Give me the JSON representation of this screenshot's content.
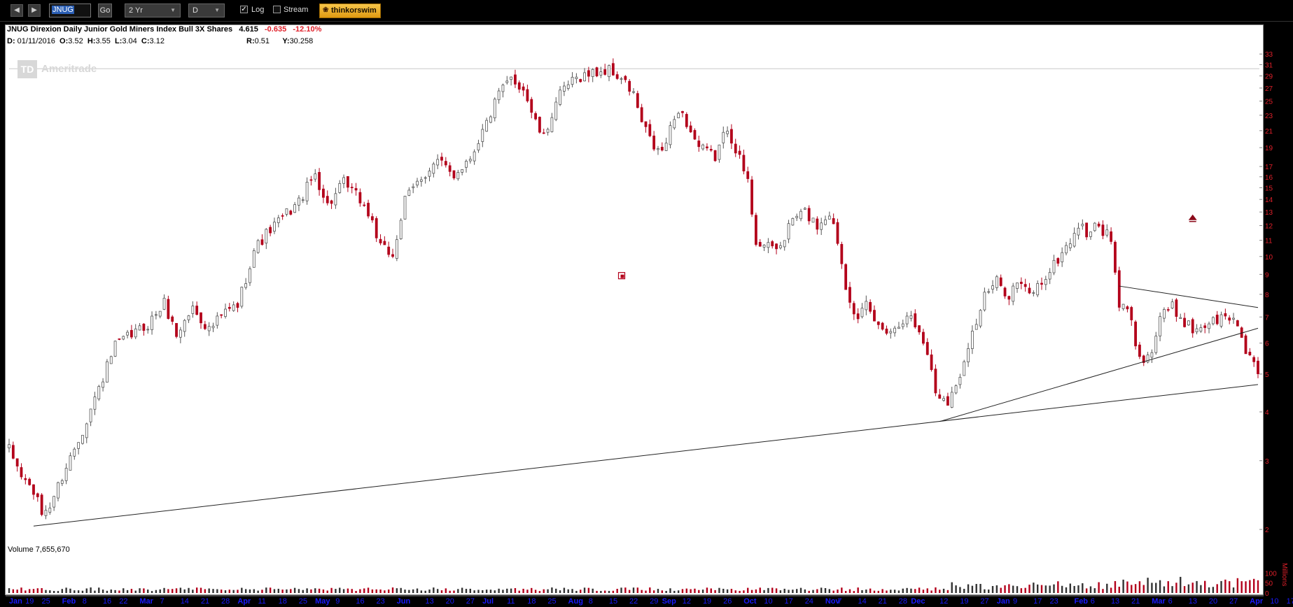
{
  "toolbar": {
    "back_icon": "left-arrow-icon",
    "forward_icon": "right-arrow-icon",
    "symbol": "JNUG",
    "go_label": "Go",
    "period": "2 Yr",
    "interval": "D",
    "log_label": "Log",
    "log_checked": true,
    "stream_label": "Stream",
    "stream_checked": false,
    "brand_label": "thinkorswim"
  },
  "header": {
    "title": "JNUG Direxion Daily Junior Gold Miners Index Bull 3X Shares",
    "last": "4.615",
    "change": "-0.635",
    "change_pct": "-12.10%",
    "date_label": "D:",
    "date": "01/11/2016",
    "open_label": "O:",
    "open": "3.52",
    "high_label": "H:",
    "high": "3.55",
    "low_label": "L:",
    "low": "3.04",
    "close_label": "C:",
    "close": "3.12",
    "r_label": "R:",
    "r": "0.51",
    "y_label": "Y:",
    "y": "30.258"
  },
  "watermark": {
    "logo": "TD",
    "text": "Ameritrade"
  },
  "volume_label": "Volume 7,655,670",
  "colors": {
    "up": "#555555",
    "down": "#b3001b",
    "axis_text": "#e0202a",
    "x_text": "#1a1aff"
  },
  "chart_data": {
    "type": "candlestick",
    "yscale": "log",
    "ylim": [
      1.85,
      34
    ],
    "y_ticks": [
      2,
      3,
      4,
      5,
      6,
      7,
      8,
      9,
      10,
      11,
      12,
      13,
      14,
      15,
      16,
      17,
      19,
      21,
      23,
      25,
      27,
      29,
      31,
      33
    ],
    "x_ticks": [
      {
        "label": "Jan",
        "i": 1
      },
      {
        "label": "19",
        "i": 5
      },
      {
        "label": "25",
        "i": 9
      },
      {
        "label": "Feb",
        "i": 14
      },
      {
        "label": "8",
        "i": 19
      },
      {
        "label": "16",
        "i": 24
      },
      {
        "label": "22",
        "i": 28
      },
      {
        "label": "Mar",
        "i": 33
      },
      {
        "label": "7",
        "i": 38
      },
      {
        "label": "14",
        "i": 43
      },
      {
        "label": "21",
        "i": 48
      },
      {
        "label": "28",
        "i": 53
      },
      {
        "label": "Apr",
        "i": 57
      },
      {
        "label": "11",
        "i": 62
      },
      {
        "label": "18",
        "i": 67
      },
      {
        "label": "25",
        "i": 72
      },
      {
        "label": "May",
        "i": 76
      },
      {
        "label": "9",
        "i": 81
      },
      {
        "label": "16",
        "i": 86
      },
      {
        "label": "23",
        "i": 91
      },
      {
        "label": "Jun",
        "i": 96
      },
      {
        "label": "13",
        "i": 103
      },
      {
        "label": "20",
        "i": 108
      },
      {
        "label": "27",
        "i": 113
      },
      {
        "label": "Jul",
        "i": 117
      },
      {
        "label": "11",
        "i": 123
      },
      {
        "label": "18",
        "i": 128
      },
      {
        "label": "25",
        "i": 133
      },
      {
        "label": "Aug",
        "i": 138
      },
      {
        "label": "8",
        "i": 143
      },
      {
        "label": "15",
        "i": 148
      },
      {
        "label": "22",
        "i": 153
      },
      {
        "label": "29",
        "i": 158
      },
      {
        "label": "Sep",
        "i": 161
      },
      {
        "label": "12",
        "i": 166
      },
      {
        "label": "19",
        "i": 171
      },
      {
        "label": "26",
        "i": 176
      },
      {
        "label": "Oct",
        "i": 181
      },
      {
        "label": "10",
        "i": 186
      },
      {
        "label": "17",
        "i": 191
      },
      {
        "label": "24",
        "i": 196
      },
      {
        "label": "Nov",
        "i": 201
      },
      {
        "label": "7",
        "i": 204
      },
      {
        "label": "14",
        "i": 209
      },
      {
        "label": "21",
        "i": 214
      },
      {
        "label": "28",
        "i": 219
      },
      {
        "label": "Dec",
        "i": 222
      },
      {
        "label": "12",
        "i": 229
      },
      {
        "label": "19",
        "i": 234
      },
      {
        "label": "27",
        "i": 239
      },
      {
        "label": "Jan",
        "i": 243
      },
      {
        "label": "9",
        "i": 247
      },
      {
        "label": "17",
        "i": 252
      },
      {
        "label": "23",
        "i": 256
      },
      {
        "label": "Feb",
        "i": 262
      },
      {
        "label": "6",
        "i": 266
      },
      {
        "label": "13",
        "i": 271
      },
      {
        "label": "21",
        "i": 276
      },
      {
        "label": "Mar",
        "i": 281
      },
      {
        "label": "6",
        "i": 285
      },
      {
        "label": "13",
        "i": 290
      },
      {
        "label": "20",
        "i": 295
      },
      {
        "label": "27",
        "i": 300
      },
      {
        "label": "Apr",
        "i": 305
      },
      {
        "label": "10",
        "i": 310
      },
      {
        "label": "17",
        "i": 314
      },
      {
        "label": "24",
        "i": 319
      }
    ],
    "anchors": [
      [
        0,
        3.2
      ],
      [
        3,
        2.75
      ],
      [
        6,
        2.5
      ],
      [
        8,
        2.2
      ],
      [
        10,
        2.3
      ],
      [
        14,
        2.9
      ],
      [
        18,
        3.6
      ],
      [
        22,
        4.6
      ],
      [
        26,
        5.9
      ],
      [
        30,
        6.3
      ],
      [
        34,
        6.7
      ],
      [
        38,
        7.6
      ],
      [
        41,
        6.3
      ],
      [
        45,
        7.4
      ],
      [
        49,
        6.5
      ],
      [
        53,
        7.2
      ],
      [
        56,
        7.5
      ],
      [
        60,
        10.4
      ],
      [
        63,
        11.4
      ],
      [
        67,
        12.6
      ],
      [
        71,
        13.8
      ],
      [
        75,
        16.3
      ],
      [
        78,
        13.5
      ],
      [
        82,
        15.4
      ],
      [
        86,
        14.0
      ],
      [
        89,
        12.3
      ],
      [
        91,
        10.5
      ],
      [
        94,
        10.1
      ],
      [
        97,
        13.9
      ],
      [
        101,
        16.0
      ],
      [
        105,
        17.5
      ],
      [
        109,
        16.2
      ],
      [
        113,
        18.0
      ],
      [
        117,
        22.0
      ],
      [
        120,
        26.0
      ],
      [
        123,
        28.5
      ],
      [
        126,
        27.0
      ],
      [
        129,
        22.0
      ],
      [
        131,
        20.0
      ],
      [
        134,
        25.0
      ],
      [
        137,
        27.5
      ],
      [
        140,
        29.0
      ],
      [
        143,
        29.5
      ],
      [
        147,
        30.0
      ],
      [
        150,
        28.5
      ],
      [
        153,
        26.0
      ],
      [
        155,
        22.0
      ],
      [
        158,
        19.0
      ],
      [
        160,
        18.5
      ],
      [
        162,
        21.0
      ],
      [
        164,
        24.0
      ],
      [
        166,
        22.0
      ],
      [
        169,
        19.0
      ],
      [
        173,
        18.0
      ],
      [
        176,
        21.5
      ],
      [
        178,
        19.0
      ],
      [
        181,
        15.5
      ],
      [
        183,
        11.0
      ],
      [
        186,
        10.5
      ],
      [
        189,
        10.6
      ],
      [
        192,
        12.5
      ],
      [
        195,
        13.0
      ],
      [
        198,
        12.0
      ],
      [
        201,
        13.0
      ],
      [
        203,
        11.0
      ],
      [
        205,
        8.5
      ],
      [
        208,
        6.8
      ],
      [
        210,
        7.5
      ],
      [
        213,
        6.6
      ],
      [
        217,
        6.5
      ],
      [
        220,
        7.2
      ],
      [
        223,
        6.4
      ],
      [
        225,
        5.7
      ],
      [
        227,
        4.5
      ],
      [
        230,
        4.3
      ],
      [
        232,
        4.6
      ],
      [
        235,
        6.0
      ],
      [
        237,
        6.8
      ],
      [
        239,
        7.9
      ],
      [
        242,
        8.6
      ],
      [
        245,
        8.0
      ],
      [
        247,
        8.6
      ],
      [
        250,
        8.0
      ],
      [
        253,
        8.6
      ],
      [
        256,
        9.5
      ],
      [
        258,
        10.2
      ],
      [
        260,
        11.0
      ],
      [
        262,
        12.0
      ],
      [
        264,
        11.5
      ],
      [
        267,
        12.0
      ],
      [
        270,
        11.0
      ],
      [
        272,
        7.3
      ],
      [
        274,
        7.5
      ],
      [
        276,
        6.0
      ],
      [
        278,
        5.5
      ],
      [
        280,
        5.7
      ],
      [
        282,
        7.0
      ],
      [
        285,
        7.4
      ],
      [
        287,
        7.0
      ],
      [
        290,
        6.5
      ],
      [
        293,
        6.7
      ],
      [
        296,
        6.9
      ],
      [
        299,
        7.0
      ],
      [
        301,
        6.7
      ],
      [
        303,
        5.8
      ],
      [
        305,
        5.4
      ],
      [
        306,
        4.9
      ]
    ],
    "n_bars": 307,
    "trendlines": [
      {
        "from": [
          6,
          2.04
        ],
        "to": [
          306,
          4.7
        ]
      },
      {
        "from": [
          228,
          3.78
        ],
        "to": [
          306,
          6.55
        ]
      },
      {
        "from": [
          272,
          8.4
        ],
        "to": [
          306,
          7.4
        ]
      }
    ],
    "ref_level": 30.258,
    "volume": {
      "unit": "Millions",
      "ticks": [
        0,
        50,
        100
      ],
      "ylim": [
        0,
        150
      ]
    },
    "markers": [
      {
        "type": "earnings",
        "i": 150,
        "price": 8.95
      },
      {
        "type": "arrow-up",
        "i": 290,
        "price": 12.6
      }
    ]
  }
}
